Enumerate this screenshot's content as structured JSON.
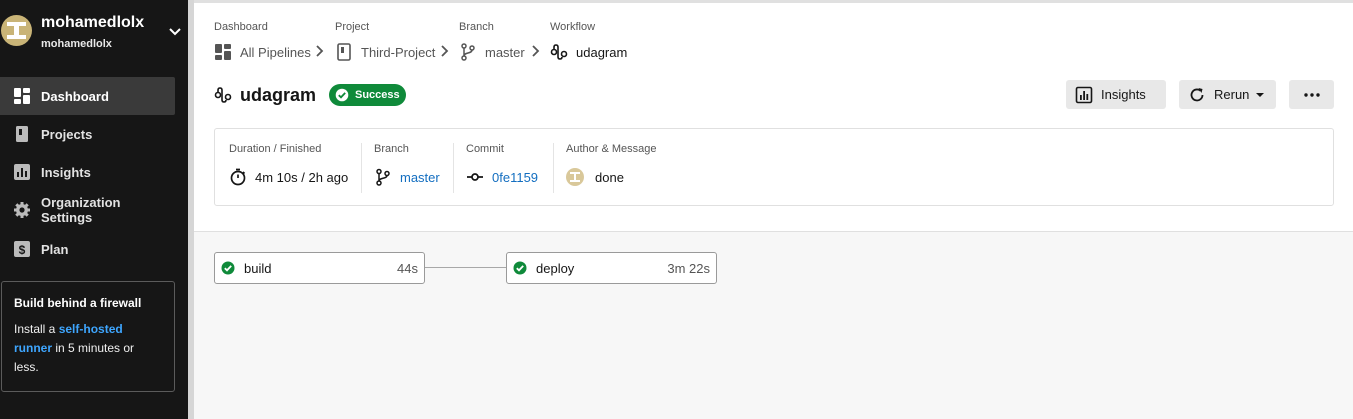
{
  "org": {
    "name": "mohamedlolx",
    "sub": "mohamedlolx"
  },
  "nav": {
    "items": [
      {
        "label": "Dashboard",
        "icon": "dashboard-icon",
        "active": true
      },
      {
        "label": "Projects",
        "icon": "projects-icon"
      },
      {
        "label": "Insights",
        "icon": "insights-icon"
      },
      {
        "label": "Organization Settings",
        "icon": "gear-icon"
      },
      {
        "label": "Plan",
        "icon": "dollar-icon"
      }
    ]
  },
  "promo": {
    "title": "Build behind a firewall",
    "text_before": "Install a ",
    "link_text": "self-hosted runner",
    "text_after": " in 5 minutes or less."
  },
  "breadcrumb": {
    "dashboard_label": "Dashboard",
    "dashboard_value": "All Pipelines",
    "project_label": "Project",
    "project_value": "Third-Project",
    "branch_label": "Branch",
    "branch_value": "master",
    "workflow_label": "Workflow",
    "workflow_value": "udagram"
  },
  "workflow": {
    "name": "udagram",
    "status": "Success",
    "status_color": "#0f8a3a"
  },
  "actions": {
    "insights": "Insights",
    "rerun": "Rerun"
  },
  "summary": {
    "duration_label": "Duration / Finished",
    "duration_value": "4m 10s / 2h ago",
    "branch_label": "Branch",
    "branch_value": "master",
    "commit_label": "Commit",
    "commit_value": "0fe1159",
    "author_label": "Author & Message",
    "author_message": "done"
  },
  "jobs": [
    {
      "name": "build",
      "duration": "44s",
      "status": "success"
    },
    {
      "name": "deploy",
      "duration": "3m 22s",
      "status": "success"
    }
  ],
  "colors": {
    "sidebar_bg": "#161616",
    "link": "#136ec0",
    "success": "#0f8a3a"
  }
}
